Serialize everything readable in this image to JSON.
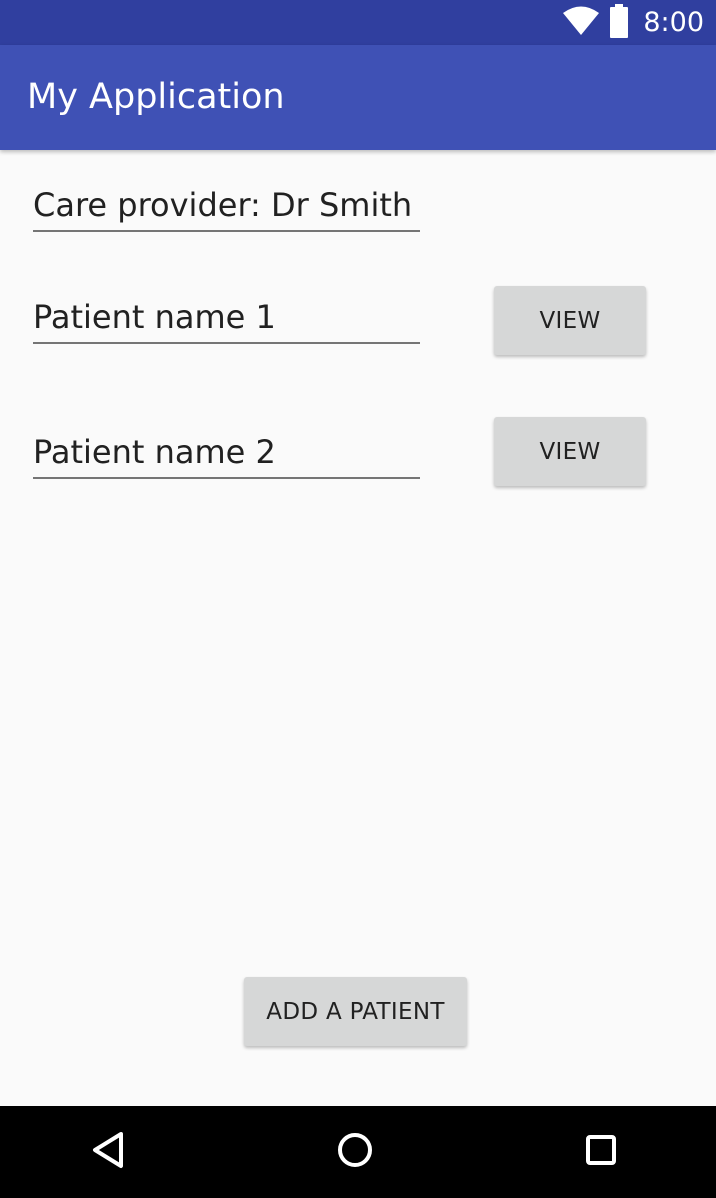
{
  "status_bar": {
    "time": "8:00",
    "icons": [
      "wifi-icon",
      "battery-icon"
    ]
  },
  "app_bar": {
    "title": "My Application"
  },
  "form": {
    "care_provider": "Care provider: Dr Smith",
    "patients": [
      {
        "name": "Patient name 1",
        "action_label": "VIEW"
      },
      {
        "name": "Patient name 2",
        "action_label": "VIEW"
      }
    ]
  },
  "actions": {
    "add_patient_label": "ADD A PATIENT"
  },
  "nav_bar": {
    "icons": [
      "back-icon",
      "home-icon",
      "recents-icon"
    ]
  },
  "colors": {
    "status_bar": "#303f9f",
    "app_bar": "#3f51b5",
    "background": "#fafafa",
    "button": "#d6d7d7",
    "nav_bar": "#000000"
  }
}
